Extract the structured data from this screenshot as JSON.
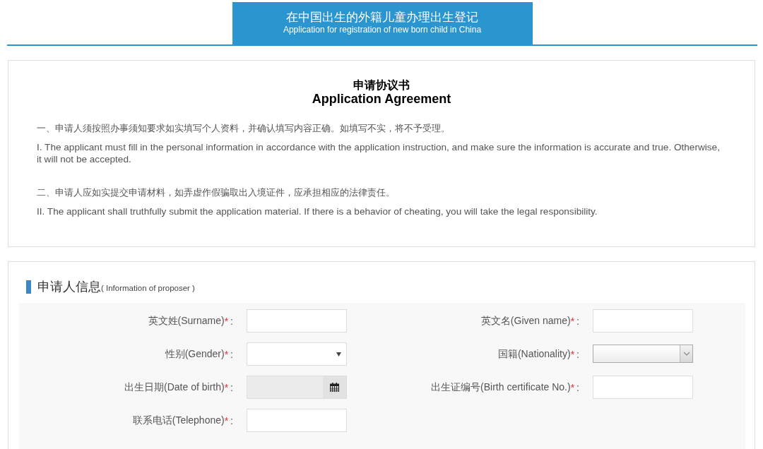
{
  "header": {
    "title": "在中国出生的外籍儿童办理出生登记",
    "subtitle": "Application for registration of new born child in China"
  },
  "agreement": {
    "title": "申请协议书",
    "title_en": "Application Agreement",
    "paragraphs": [
      {
        "kind": "zh",
        "text": "一、申请人须按照办事须知要求如实填写个人资料，并确认填写内容正确。如填写不实，将不予受理。"
      },
      {
        "kind": "en",
        "text": "I. The applicant must fill in the personal information in accordance with the application instruction, and make sure the information is accurate and true. Otherwise, it will not be accepted."
      },
      {
        "kind": "zh",
        "text": "二、申请人应如实提交申请材料，如弄虚作假骗取出入境证件，应承担相应的法律责任。"
      },
      {
        "kind": "en",
        "text": "II. The applicant shall truthfully submit the application material. If there is a behavior of cheating, you will take the legal responsibility."
      }
    ]
  },
  "proposer": {
    "heading": "申请人信息",
    "heading_note": "( Information of proposer )",
    "fields": [
      {
        "kind": "text",
        "label": "英文姓(Surname)",
        "mark": "*",
        "colon": ":"
      },
      {
        "kind": "text",
        "label": "英文名(Given name)",
        "mark": "*",
        "colon": ":"
      },
      {
        "kind": "dropdown",
        "label": "性别(Gender)",
        "mark": "*",
        "colon": ":"
      },
      {
        "kind": "select",
        "label": "国籍(Nationality)",
        "mark": "*",
        "colon": ":"
      },
      {
        "kind": "date",
        "label": "出生日期(Date of birth)",
        "mark": "*",
        "colon": ":"
      },
      {
        "kind": "text",
        "label": "出生证编号(Birth certificate No.)",
        "mark": "*",
        "colon": ":"
      },
      {
        "kind": "text",
        "label": "联系电话(Telephone)",
        "mark": "*",
        "colon": ":"
      }
    ]
  }
}
